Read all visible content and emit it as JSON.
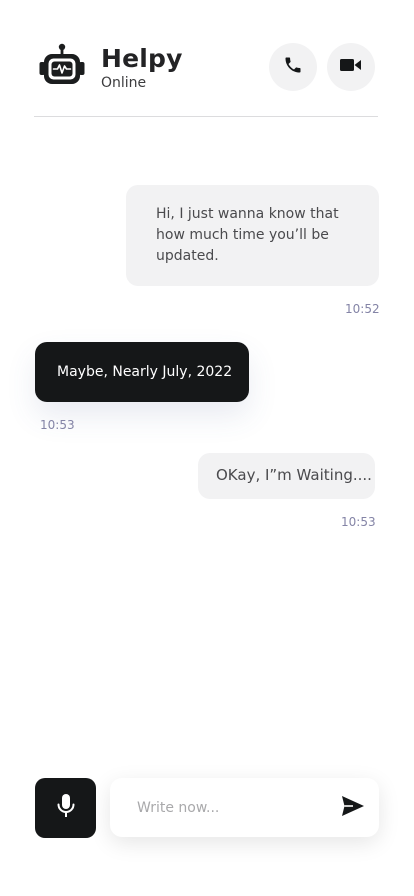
{
  "header": {
    "title": "Helpy",
    "status": "Online",
    "call_icon": "phone-icon",
    "video_icon": "video-camera-icon",
    "avatar_icon": "robot-icon"
  },
  "messages": [
    {
      "direction": "outgoing",
      "text": "Hi, I just wanna know that how much time you’ll be updated.",
      "time": "10:52"
    },
    {
      "direction": "incoming",
      "text": "Maybe, Nearly July, 2022",
      "time": "10:53"
    },
    {
      "direction": "outgoing",
      "text": "OKay, I”m Waiting....",
      "time": "10:53"
    }
  ],
  "composer": {
    "placeholder": "Write now...",
    "value": "",
    "mic_icon": "microphone-icon",
    "send_icon": "send-icon"
  },
  "colors": {
    "dark": "#151718",
    "bubble_light": "#f2f2f3",
    "timestamp": "#8484a6",
    "background": "#ffffff"
  }
}
